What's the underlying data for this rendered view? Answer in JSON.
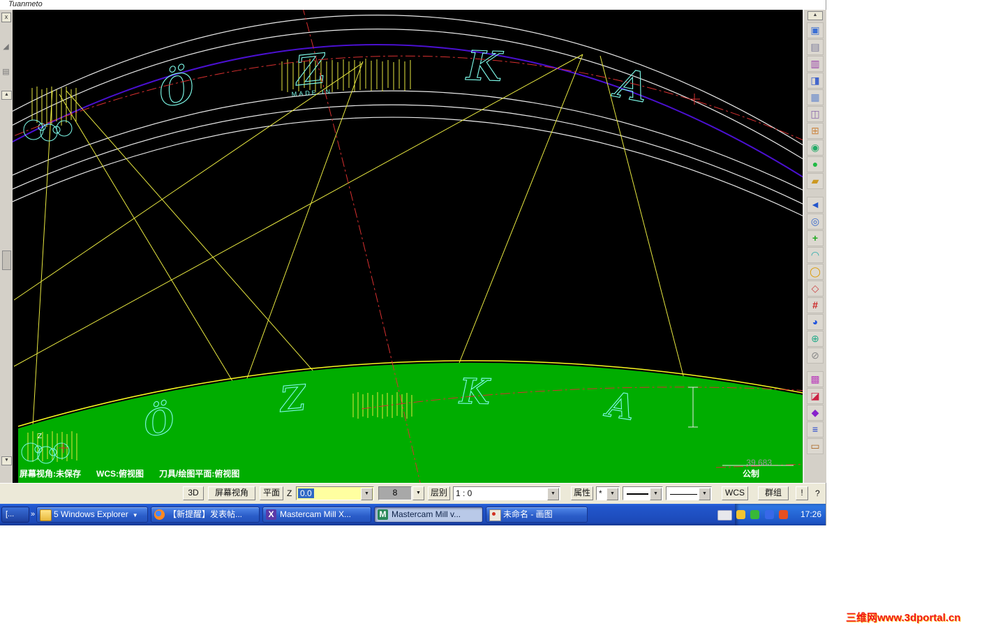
{
  "menubar": {
    "title": "Tuanmeto"
  },
  "left_panel": {
    "close_label": "x"
  },
  "viewport": {
    "status": {
      "view_state": "屏幕视角:未保存",
      "wcs": "WCS:俯视图",
      "tool_plane": "刀具/绘图平面:俯视图"
    },
    "dimension": "39.683",
    "units": "公制",
    "logo_letters": [
      "Ö",
      "Z",
      "K",
      "A"
    ],
    "logo_subtext": "MADE IN",
    "axis_z_label": "Z",
    "colors": {
      "background": "#000000",
      "band_green": "#00ad00",
      "wireframe_cyan": "#7df9e8",
      "construction_yellow": "#e8e840",
      "centerline_red": "#d83030",
      "arc_purple": "#4a10d0",
      "arc_white": "#e8e8e8"
    }
  },
  "ribbon": {
    "mode": "3D",
    "view": "屏幕视角",
    "plane": "平面",
    "z": "Z",
    "z_value": "0.0",
    "depth": "8",
    "layer": "层别",
    "layer_value": "1 : 0",
    "attributes": "属性",
    "point_style": "*",
    "wcs": "WCS",
    "group": "群组",
    "alert": "!",
    "help": "?"
  },
  "right_toolbar": {
    "icons": [
      {
        "name": "save-screen",
        "glyph": "▣"
      },
      {
        "name": "print",
        "glyph": "▤"
      },
      {
        "name": "plot",
        "glyph": "▥"
      },
      {
        "name": "copy-image",
        "glyph": "◨"
      },
      {
        "name": "screen-capture",
        "glyph": "▦"
      },
      {
        "name": "file-convert",
        "glyph": "◫"
      },
      {
        "name": "combine-views",
        "glyph": "⊞"
      },
      {
        "name": "analyze-entity",
        "glyph": "◉"
      },
      {
        "name": "shaded-sphere",
        "glyph": "●"
      },
      {
        "name": "edit-erase",
        "glyph": "▰"
      },
      {
        "name": "previous-view",
        "glyph": "◄"
      },
      {
        "name": "zoom-window",
        "glyph": "◎"
      },
      {
        "name": "zoom-fit",
        "glyph": "+"
      },
      {
        "name": "repaint",
        "glyph": "◠"
      },
      {
        "name": "dynamic-rotate",
        "glyph": "◯"
      },
      {
        "name": "curve-tool",
        "glyph": "◇"
      },
      {
        "name": "grid",
        "glyph": "#"
      },
      {
        "name": "shading",
        "glyph": "◕"
      },
      {
        "name": "gview-iso",
        "glyph": "⊕"
      },
      {
        "name": "blank-entity",
        "glyph": "⊘"
      },
      {
        "name": "color-palette",
        "glyph": "▩"
      },
      {
        "name": "attribute-set",
        "glyph": "◪"
      },
      {
        "name": "entity-mask",
        "glyph": "◆"
      },
      {
        "name": "level-manager",
        "glyph": "≡"
      },
      {
        "name": "viewsheet",
        "glyph": "▭"
      }
    ]
  },
  "taskbar": {
    "quick_launch": "[...",
    "chevron": "»",
    "buttons": [
      {
        "label": "5 Windows Explorer"
      },
      {
        "label": "【新提醒】发表帖..."
      },
      {
        "label": "Mastercam Mill X..."
      },
      {
        "label": "Mastercam Mill v..."
      },
      {
        "label": "未命名 - 画图"
      }
    ],
    "clock": "17:26"
  },
  "watermark": "三维网www.3dportal.cn"
}
